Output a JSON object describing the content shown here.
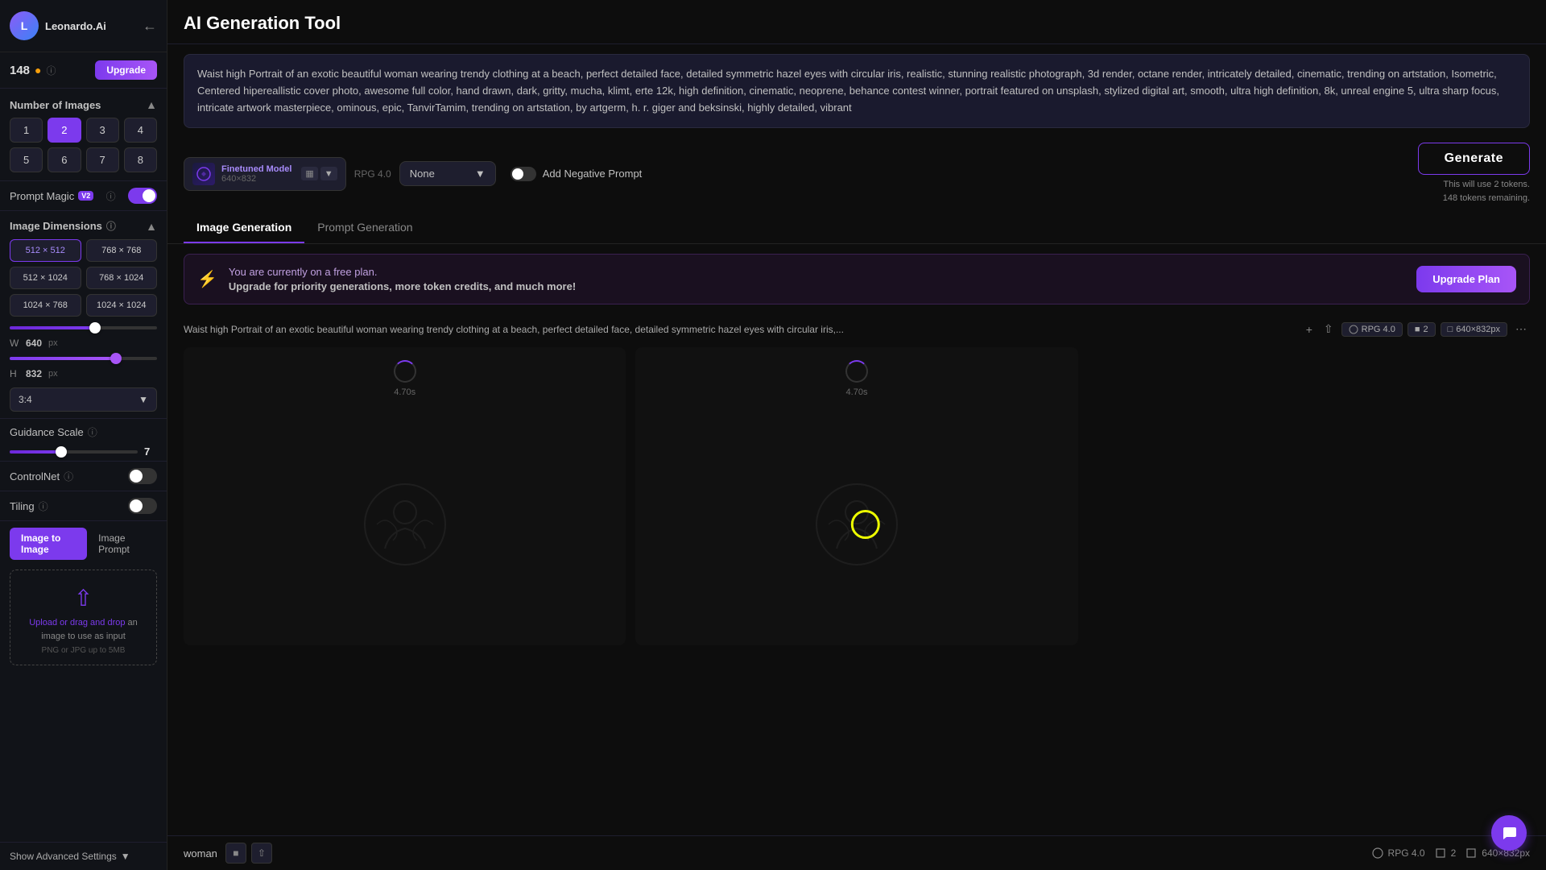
{
  "app": {
    "title": "AI Generation Tool",
    "username": "Leonardo.Ai",
    "avatar_initials": "L"
  },
  "sidebar": {
    "token_count": "148",
    "upgrade_label": "Upgrade",
    "number_of_images_title": "Number of Images",
    "numbers": [
      "1",
      "2",
      "3",
      "4",
      "5",
      "6",
      "7",
      "8"
    ],
    "active_number": 1,
    "prompt_magic_label": "Prompt Magic",
    "prompt_magic_version": "V2",
    "image_dimensions_title": "Image Dimensions",
    "dim_options": [
      "512 × 512",
      "768 × 768",
      "512 × 1024",
      "768 × 1024",
      "1024 × 768",
      "1024 × 1024"
    ],
    "active_dim": 0,
    "width_value": "640",
    "height_value": "832",
    "width_unit": "px",
    "height_unit": "px",
    "ratio_value": "3:4",
    "guidance_scale_label": "Guidance Scale",
    "guidance_value": "7",
    "controlnet_label": "ControlNet",
    "tiling_label": "Tiling",
    "img2img_tab": "Image to Image",
    "img_prompt_tab": "Image Prompt",
    "upload_text_link": "Upload or drag and drop",
    "upload_text_suffix": " an image to use as input",
    "upload_hint": "PNG or JPG up to 5MB",
    "show_advanced_label": "Show Advanced Settings"
  },
  "toolbar": {
    "model_label": "Finetuned Model",
    "model_res": "640×832",
    "model_name": "RPG 4.0",
    "none_label": "None",
    "neg_prompt_label": "Add Negative Prompt",
    "generate_label": "Generate",
    "gen_cost": "This will use 2 tokens.",
    "gen_remaining": "148 tokens remaining."
  },
  "tabs": {
    "image_gen": "Image Generation",
    "prompt_gen": "Prompt Generation"
  },
  "banner": {
    "title": "You are currently on a free plan.",
    "subtitle": "Upgrade for priority generations, more token credits, and much more!",
    "button_label": "Upgrade Plan"
  },
  "generation": {
    "prompt_preview": "Waist high Portrait of an exotic beautiful woman wearing trendy clothing at a beach, perfect detailed face, detailed symmetric hazel eyes with circular iris,...",
    "model_badge": "RPG 4.0",
    "count_badge": "2",
    "res_badge": "640×832px",
    "timer1": "4.70s",
    "timer2": "4.70s"
  },
  "prompt": {
    "text": "Waist high Portrait of an exotic beautiful woman wearing trendy clothing at a beach,  perfect detailed face, detailed symmetric hazel eyes with circular iris, realistic, stunning realistic photograph, 3d render, octane render, intricately detailed, cinematic, trending on artstation, Isometric, Centered hipereallistic cover photo, awesome full color, hand drawn, dark, gritty, mucha, klimt, erte 12k, high definition, cinematic, neoprene, behance contest winner, portrait featured on unsplash, stylized digital art, smooth, ultra high definition, 8k, unreal engine 5, ultra sharp focus, intricate artwork masterpiece, ominous, epic, TanvirTamim, trending on artstation, by artgerm, h. r. giger and beksinski, highly detailed, vibrant"
  },
  "bottom": {
    "tag": "woman",
    "model": "RPG 4.0",
    "count": "2",
    "res": "640×832px"
  }
}
